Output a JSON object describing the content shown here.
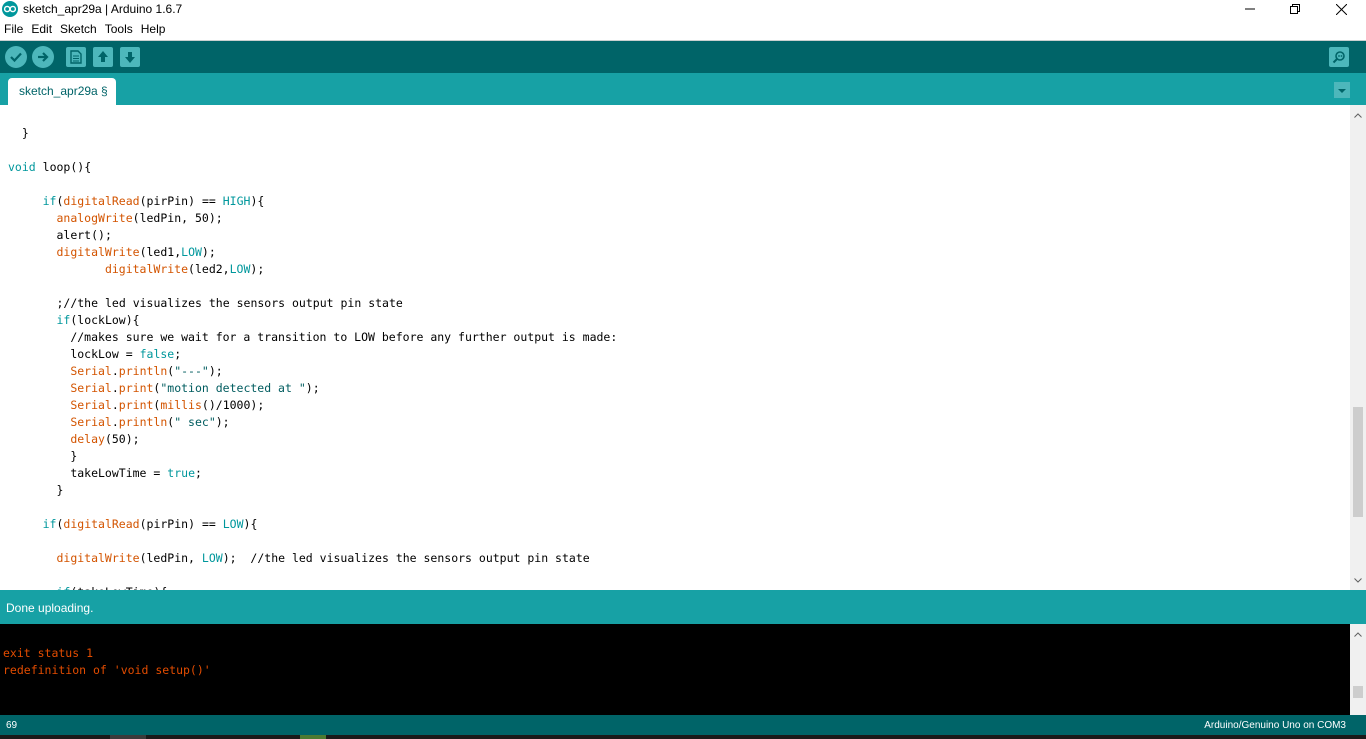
{
  "window": {
    "title": "sketch_apr29a | Arduino 1.6.7"
  },
  "menu": [
    "File",
    "Edit",
    "Sketch",
    "Tools",
    "Help"
  ],
  "tabs": [
    {
      "label": "sketch_apr29a §"
    }
  ],
  "editor": {
    "lines": [
      "  }",
      "",
      "void loop(){",
      "",
      "     if(digitalRead(pirPin) == HIGH){",
      "       analogWrite(ledPin, 50);",
      "       alert();",
      "       digitalWrite(led1,LOW);",
      "              digitalWrite(led2,LOW);",
      "",
      "       ;//the led visualizes the sensors output pin state",
      "       if(lockLow){",
      "         //makes sure we wait for a transition to LOW before any further output is made:",
      "         lockLow = false;",
      "         Serial.println(\"---\");",
      "         Serial.print(\"motion detected at \");",
      "         Serial.print(millis()/1000);",
      "         Serial.println(\" sec\");",
      "         delay(50);",
      "         }",
      "         takeLowTime = true;",
      "       }",
      "",
      "     if(digitalRead(pirPin) == LOW){",
      "",
      "       digitalWrite(ledPin, LOW);  //the led visualizes the sensors output pin state",
      "",
      "       if(takeLowTime){"
    ]
  },
  "status": {
    "message": "Done uploading."
  },
  "console": {
    "lines": [
      "exit status 1",
      "redefinition of 'void setup()'"
    ]
  },
  "footer": {
    "line_number": "69",
    "board": "Arduino/Genuino Uno on COM3"
  },
  "colors": {
    "toolbar": "#006468",
    "tabbar": "#17a1a5",
    "keyword": "#00979c",
    "function": "#d35400",
    "console_text": "#e34c00"
  },
  "icons": {
    "toolbar": [
      "verify-icon",
      "upload-icon",
      "new-icon",
      "open-icon",
      "save-icon",
      "serial-monitor-icon"
    ]
  }
}
